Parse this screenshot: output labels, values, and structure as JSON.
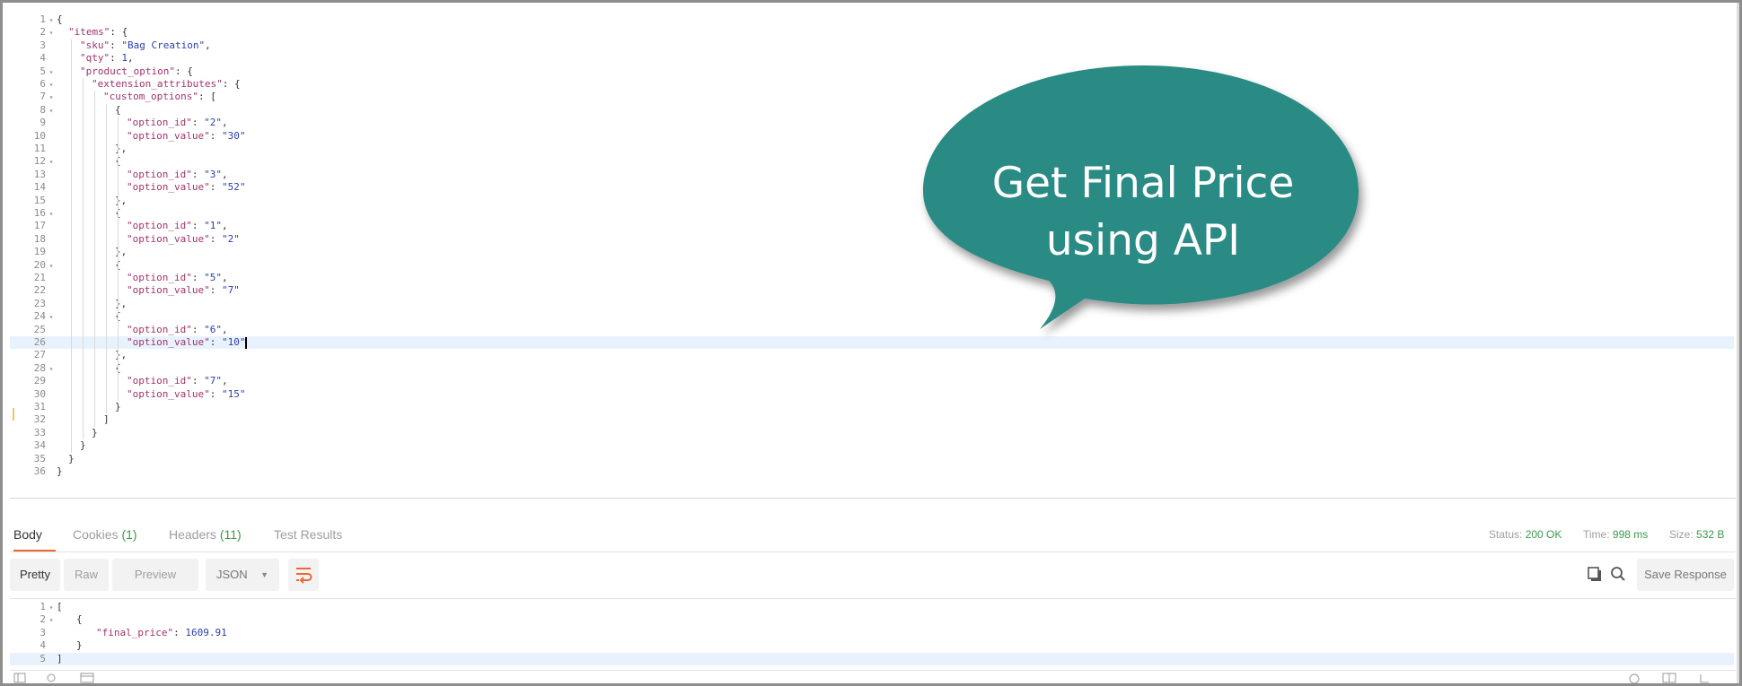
{
  "request_editor": {
    "lines": [
      {
        "n": "1",
        "fold": true,
        "indent": 0,
        "parts": [
          [
            "p",
            "{"
          ]
        ]
      },
      {
        "n": "2",
        "fold": true,
        "indent": 1,
        "parts": [
          [
            "k",
            "\"items\""
          ],
          [
            "p",
            ": {"
          ]
        ]
      },
      {
        "n": "3",
        "fold": false,
        "indent": 2,
        "parts": [
          [
            "k",
            "\"sku\""
          ],
          [
            "p",
            ": "
          ],
          [
            "s",
            "\"Bag Creation\""
          ],
          [
            "p",
            ","
          ]
        ]
      },
      {
        "n": "4",
        "fold": false,
        "indent": 2,
        "parts": [
          [
            "k",
            "\"qty\""
          ],
          [
            "p",
            ": "
          ],
          [
            "n",
            "1"
          ],
          [
            "p",
            ","
          ]
        ]
      },
      {
        "n": "5",
        "fold": true,
        "indent": 2,
        "parts": [
          [
            "k",
            "\"product_option\""
          ],
          [
            "p",
            ": {"
          ]
        ]
      },
      {
        "n": "6",
        "fold": true,
        "indent": 3,
        "parts": [
          [
            "k",
            "\"extension_attributes\""
          ],
          [
            "p",
            ": {"
          ]
        ]
      },
      {
        "n": "7",
        "fold": true,
        "indent": 4,
        "parts": [
          [
            "k",
            "\"custom_options\""
          ],
          [
            "p",
            ": ["
          ]
        ]
      },
      {
        "n": "8",
        "fold": true,
        "indent": 5,
        "parts": [
          [
            "p",
            "{"
          ]
        ]
      },
      {
        "n": "9",
        "fold": false,
        "indent": 6,
        "parts": [
          [
            "k",
            "\"option_id\""
          ],
          [
            "p",
            ": "
          ],
          [
            "s",
            "\"2\""
          ],
          [
            "p",
            ","
          ]
        ]
      },
      {
        "n": "10",
        "fold": false,
        "indent": 6,
        "parts": [
          [
            "k",
            "\"option_value\""
          ],
          [
            "p",
            ": "
          ],
          [
            "s",
            "\"30\""
          ]
        ]
      },
      {
        "n": "11",
        "fold": false,
        "indent": 5,
        "parts": [
          [
            "p",
            "},"
          ]
        ]
      },
      {
        "n": "12",
        "fold": true,
        "indent": 5,
        "parts": [
          [
            "p",
            "{"
          ]
        ]
      },
      {
        "n": "13",
        "fold": false,
        "indent": 6,
        "parts": [
          [
            "k",
            "\"option_id\""
          ],
          [
            "p",
            ": "
          ],
          [
            "s",
            "\"3\""
          ],
          [
            "p",
            ","
          ]
        ]
      },
      {
        "n": "14",
        "fold": false,
        "indent": 6,
        "parts": [
          [
            "k",
            "\"option_value\""
          ],
          [
            "p",
            ": "
          ],
          [
            "s",
            "\"52\""
          ]
        ]
      },
      {
        "n": "15",
        "fold": false,
        "indent": 5,
        "parts": [
          [
            "p",
            "},"
          ]
        ]
      },
      {
        "n": "16",
        "fold": true,
        "indent": 5,
        "parts": [
          [
            "p",
            "{"
          ]
        ]
      },
      {
        "n": "17",
        "fold": false,
        "indent": 6,
        "parts": [
          [
            "k",
            "\"option_id\""
          ],
          [
            "p",
            ": "
          ],
          [
            "s",
            "\"1\""
          ],
          [
            "p",
            ","
          ]
        ]
      },
      {
        "n": "18",
        "fold": false,
        "indent": 6,
        "parts": [
          [
            "k",
            "\"option_value\""
          ],
          [
            "p",
            ": "
          ],
          [
            "s",
            "\"2\""
          ]
        ]
      },
      {
        "n": "19",
        "fold": false,
        "indent": 5,
        "parts": [
          [
            "p",
            "},"
          ]
        ]
      },
      {
        "n": "20",
        "fold": true,
        "indent": 5,
        "parts": [
          [
            "p",
            "{"
          ]
        ]
      },
      {
        "n": "21",
        "fold": false,
        "indent": 6,
        "parts": [
          [
            "k",
            "\"option_id\""
          ],
          [
            "p",
            ": "
          ],
          [
            "s",
            "\"5\""
          ],
          [
            "p",
            ","
          ]
        ]
      },
      {
        "n": "22",
        "fold": false,
        "indent": 6,
        "parts": [
          [
            "k",
            "\"option_value\""
          ],
          [
            "p",
            ": "
          ],
          [
            "s",
            "\"7\""
          ]
        ]
      },
      {
        "n": "23",
        "fold": false,
        "indent": 5,
        "parts": [
          [
            "p",
            "},"
          ]
        ]
      },
      {
        "n": "24",
        "fold": true,
        "indent": 5,
        "parts": [
          [
            "p",
            "{"
          ]
        ]
      },
      {
        "n": "25",
        "fold": false,
        "indent": 6,
        "parts": [
          [
            "k",
            "\"option_id\""
          ],
          [
            "p",
            ": "
          ],
          [
            "s",
            "\"6\""
          ],
          [
            "p",
            ","
          ]
        ]
      },
      {
        "n": "26",
        "fold": false,
        "indent": 6,
        "highlight": true,
        "cursor": true,
        "parts": [
          [
            "k",
            "\"option_value\""
          ],
          [
            "p",
            ": "
          ],
          [
            "s",
            "\"10\""
          ]
        ]
      },
      {
        "n": "27",
        "fold": false,
        "indent": 5,
        "parts": [
          [
            "p",
            "},"
          ]
        ]
      },
      {
        "n": "28",
        "fold": true,
        "indent": 5,
        "parts": [
          [
            "p",
            "{"
          ]
        ]
      },
      {
        "n": "29",
        "fold": false,
        "indent": 6,
        "parts": [
          [
            "k",
            "\"option_id\""
          ],
          [
            "p",
            ": "
          ],
          [
            "s",
            "\"7\""
          ],
          [
            "p",
            ","
          ]
        ]
      },
      {
        "n": "30",
        "fold": false,
        "indent": 6,
        "parts": [
          [
            "k",
            "\"option_value\""
          ],
          [
            "p",
            ": "
          ],
          [
            "s",
            "\"15\""
          ]
        ]
      },
      {
        "n": "31",
        "fold": false,
        "indent": 5,
        "parts": [
          [
            "p",
            "}"
          ]
        ]
      },
      {
        "n": "32",
        "fold": false,
        "indent": 4,
        "parts": [
          [
            "p",
            "]"
          ]
        ]
      },
      {
        "n": "33",
        "fold": false,
        "indent": 3,
        "parts": [
          [
            "p",
            "}"
          ]
        ]
      },
      {
        "n": "34",
        "fold": false,
        "indent": 2,
        "parts": [
          [
            "p",
            "}"
          ]
        ]
      },
      {
        "n": "35",
        "fold": false,
        "indent": 1,
        "parts": [
          [
            "p",
            "}"
          ]
        ]
      },
      {
        "n": "36",
        "fold": false,
        "indent": 0,
        "parts": [
          [
            "p",
            "}"
          ]
        ]
      }
    ]
  },
  "callout": {
    "line1": "Get Final Price",
    "line2": "using API",
    "color": "#2b8a84"
  },
  "response_tabs": [
    {
      "label": "Body",
      "count": "",
      "active": true
    },
    {
      "label": "Cookies",
      "count": "(1)",
      "active": false
    },
    {
      "label": "Headers",
      "count": "(11)",
      "active": false
    },
    {
      "label": "Test Results",
      "count": "",
      "active": false
    }
  ],
  "status": {
    "status_label": "Status:",
    "status_value": "200 OK",
    "time_label": "Time:",
    "time_value": "998 ms",
    "size_label": "Size:",
    "size_value": "532 B"
  },
  "response_toolbar": {
    "pretty": "Pretty",
    "raw": "Raw",
    "preview": "Preview",
    "format": "JSON",
    "save": "Save Response",
    "accent": "#e66a35"
  },
  "response_body": {
    "lines": [
      {
        "n": "1",
        "fold": true,
        "indent": 0,
        "parts": [
          [
            "p",
            "["
          ]
        ],
        "bracket": true
      },
      {
        "n": "2",
        "fold": true,
        "indent": 1,
        "parts": [
          [
            "p",
            "{"
          ]
        ]
      },
      {
        "n": "3",
        "fold": false,
        "indent": 2,
        "parts": [
          [
            "k",
            "\"final_price\""
          ],
          [
            "p",
            ": "
          ],
          [
            "n",
            "1609.91"
          ]
        ]
      },
      {
        "n": "4",
        "fold": false,
        "indent": 1,
        "parts": [
          [
            "p",
            "}"
          ]
        ]
      },
      {
        "n": "5",
        "fold": false,
        "indent": 0,
        "highlight": true,
        "parts": [
          [
            "p",
            "]"
          ]
        ],
        "bracket": true
      }
    ]
  }
}
